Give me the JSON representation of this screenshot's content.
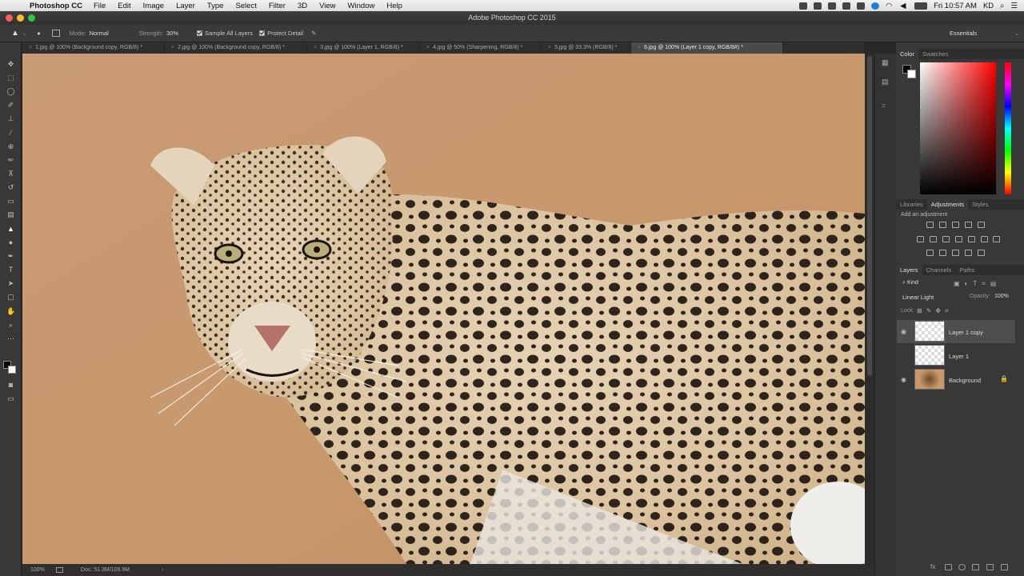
{
  "menubar": {
    "app_name": "Photoshop CC",
    "items": [
      "File",
      "Edit",
      "Image",
      "Layer",
      "Type",
      "Select",
      "Filter",
      "3D",
      "View",
      "Window",
      "Help"
    ],
    "clock": "Fri 10:57 AM",
    "user": "KD"
  },
  "window": {
    "title": "Adobe Photoshop CC 2015",
    "workspace": "Essentials"
  },
  "options_bar": {
    "mode_label": "Mode:",
    "mode_value": "Normal",
    "strength_label": "Strength:",
    "strength_value": "30%",
    "sample_all_layers": "Sample All Layers",
    "protect_detail": "Protect Detail"
  },
  "tabs": [
    "1.jpg @ 100% (Background copy, RGB/8) *",
    "2.jpg @ 100% (Background copy, RGB/8) *",
    "3.jpg @ 100% (Layer 1, RGB/8) *",
    "4.jpg @ 50% (Sharpening, RGB/8) *",
    "5.jpg @ 33.3% (RGB/8) *",
    "6.jpg @ 100% (Layer 1 copy, RGB/8#) *"
  ],
  "status": {
    "zoom": "100%",
    "doc": "Doc: 51.3M/109.9M"
  },
  "color_panel": {
    "tabs": [
      "Color",
      "Swatches"
    ]
  },
  "adjustments_panel": {
    "tabs": [
      "Libraries",
      "Adjustments",
      "Styles"
    ],
    "hint": "Add an adjustment"
  },
  "layers_panel": {
    "tabs": [
      "Layers",
      "Channels",
      "Paths"
    ],
    "filter_label": "Kind",
    "blend_mode": "Linear Light",
    "opacity_label": "Opacity:",
    "opacity_value": "100%",
    "lock_label": "Lock:",
    "layers": [
      {
        "name": "Layer 1 copy",
        "visible": true,
        "selected": true
      },
      {
        "name": "Layer 1",
        "visible": false,
        "selected": false
      },
      {
        "name": "Background",
        "visible": true,
        "selected": false,
        "locked": true
      }
    ]
  },
  "colors": {
    "accent": "#2f8bd6",
    "panel": "#383838",
    "canvas_bg": "#c89a72"
  }
}
